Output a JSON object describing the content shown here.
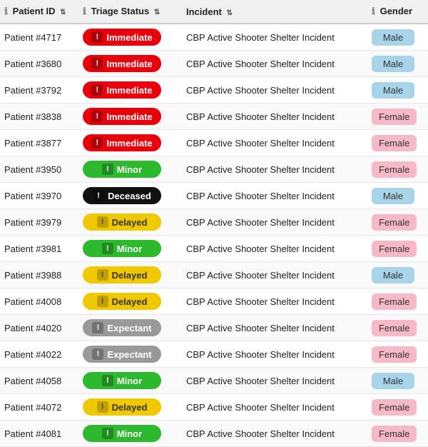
{
  "table": {
    "headers": [
      {
        "id": "patient-id",
        "label": "Patient ID",
        "has_info": true,
        "has_sort": true
      },
      {
        "id": "triage-status",
        "label": "Triage Status",
        "has_info": true,
        "has_sort": true
      },
      {
        "id": "incident",
        "label": "Incident",
        "has_info": false,
        "has_sort": true
      },
      {
        "id": "gender",
        "label": "Gender",
        "has_info": true,
        "has_sort": false
      }
    ],
    "rows": [
      {
        "patient_id": "Patient #4717",
        "triage": "Immediate",
        "triage_class": "immediate",
        "incident": "CBP Active Shooter Shelter Incident",
        "gender": "Male",
        "gender_class": "male"
      },
      {
        "patient_id": "Patient #3680",
        "triage": "Immediate",
        "triage_class": "immediate",
        "incident": "CBP Active Shooter Shelter Incident",
        "gender": "Male",
        "gender_class": "male"
      },
      {
        "patient_id": "Patient #3792",
        "triage": "Immediate",
        "triage_class": "immediate",
        "incident": "CBP Active Shooter Shelter Incident",
        "gender": "Male",
        "gender_class": "male"
      },
      {
        "patient_id": "Patient #3838",
        "triage": "Immediate",
        "triage_class": "immediate",
        "incident": "CBP Active Shooter Shelter Incident",
        "gender": "Female",
        "gender_class": "female"
      },
      {
        "patient_id": "Patient #3877",
        "triage": "Immediate",
        "triage_class": "immediate",
        "incident": "CBP Active Shooter Shelter Incident",
        "gender": "Female",
        "gender_class": "female"
      },
      {
        "patient_id": "Patient #3950",
        "triage": "Minor",
        "triage_class": "minor",
        "incident": "CBP Active Shooter Shelter Incident",
        "gender": "Female",
        "gender_class": "female"
      },
      {
        "patient_id": "Patient #3970",
        "triage": "Deceased",
        "triage_class": "deceased",
        "incident": "CBP Active Shooter Shelter Incident",
        "gender": "Male",
        "gender_class": "male"
      },
      {
        "patient_id": "Patient #3979",
        "triage": "Delayed",
        "triage_class": "delayed",
        "incident": "CBP Active Shooter Shelter Incident",
        "gender": "Female",
        "gender_class": "female"
      },
      {
        "patient_id": "Patient #3981",
        "triage": "Minor",
        "triage_class": "minor",
        "incident": "CBP Active Shooter Shelter Incident",
        "gender": "Female",
        "gender_class": "female"
      },
      {
        "patient_id": "Patient #3988",
        "triage": "Delayed",
        "triage_class": "delayed",
        "incident": "CBP Active Shooter Shelter Incident",
        "gender": "Male",
        "gender_class": "male"
      },
      {
        "patient_id": "Patient #4008",
        "triage": "Delayed",
        "triage_class": "delayed",
        "incident": "CBP Active Shooter Shelter Incident",
        "gender": "Female",
        "gender_class": "female"
      },
      {
        "patient_id": "Patient #4020",
        "triage": "Expectant",
        "triage_class": "expectant",
        "incident": "CBP Active Shooter Shelter Incident",
        "gender": "Female",
        "gender_class": "female"
      },
      {
        "patient_id": "Patient #4022",
        "triage": "Expectant",
        "triage_class": "expectant",
        "incident": "CBP Active Shooter Shelter Incident",
        "gender": "Female",
        "gender_class": "female"
      },
      {
        "patient_id": "Patient #4058",
        "triage": "Minor",
        "triage_class": "minor",
        "incident": "CBP Active Shooter Shelter Incident",
        "gender": "Male",
        "gender_class": "male"
      },
      {
        "patient_id": "Patient #4072",
        "triage": "Delayed",
        "triage_class": "delayed",
        "incident": "CBP Active Shooter Shelter Incident",
        "gender": "Female",
        "gender_class": "female"
      },
      {
        "patient_id": "Patient #4081",
        "triage": "Minor",
        "triage_class": "minor",
        "incident": "CBP Active Shooter Shelter Incident",
        "gender": "Female",
        "gender_class": "female"
      }
    ]
  }
}
